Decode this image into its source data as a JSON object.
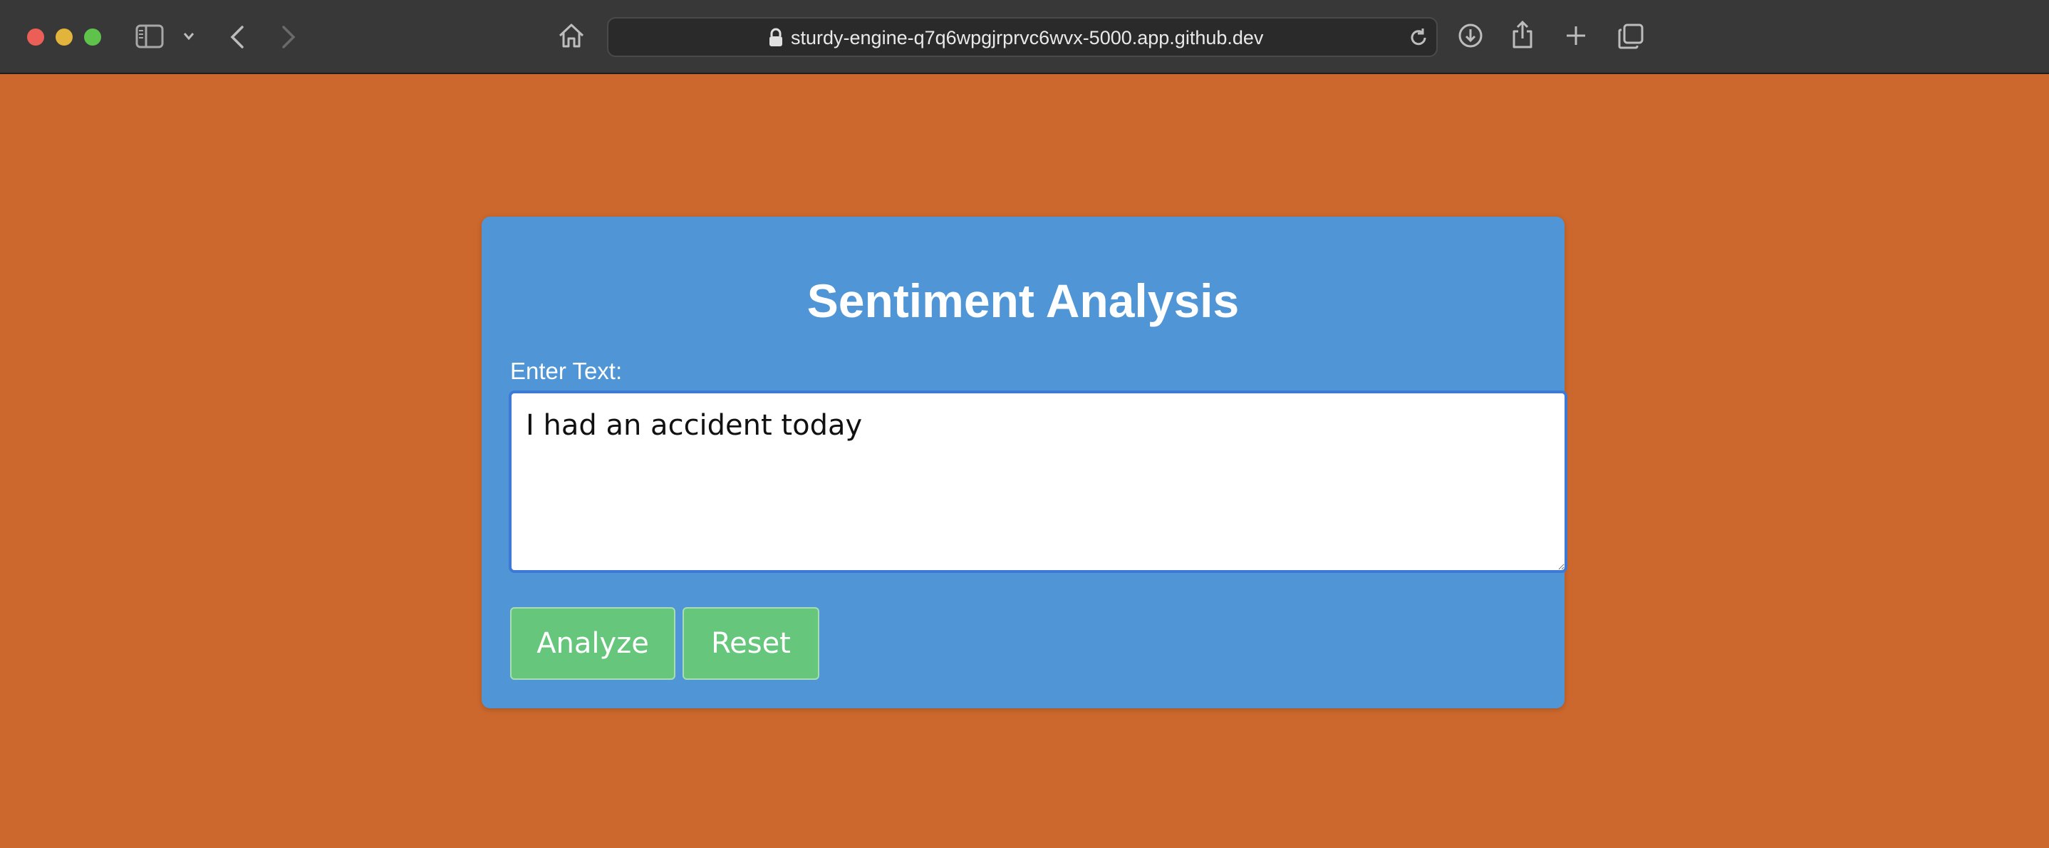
{
  "browser": {
    "url": "sturdy-engine-q7q6wpgjrprvc6wvx-5000.app.github.dev",
    "icons": [
      "close-button",
      "minimize-button",
      "zoom-button",
      "sidebar-icon",
      "chevron-down-icon",
      "back-arrow-icon",
      "forward-arrow-icon",
      "home-icon",
      "lock-icon",
      "reload-icon",
      "download-icon",
      "share-icon",
      "plus-icon",
      "tabs-icon"
    ]
  },
  "page": {
    "title": "Sentiment Analysis",
    "input_label": "Enter Text:",
    "input_value": "I had an accident today",
    "analyze_label": "Analyze",
    "reset_label": "Reset"
  },
  "colors": {
    "page_background": "#cc682d",
    "card_background": "#5096d6",
    "button_background": "#65c67c",
    "toolbar_background": "#383838"
  }
}
